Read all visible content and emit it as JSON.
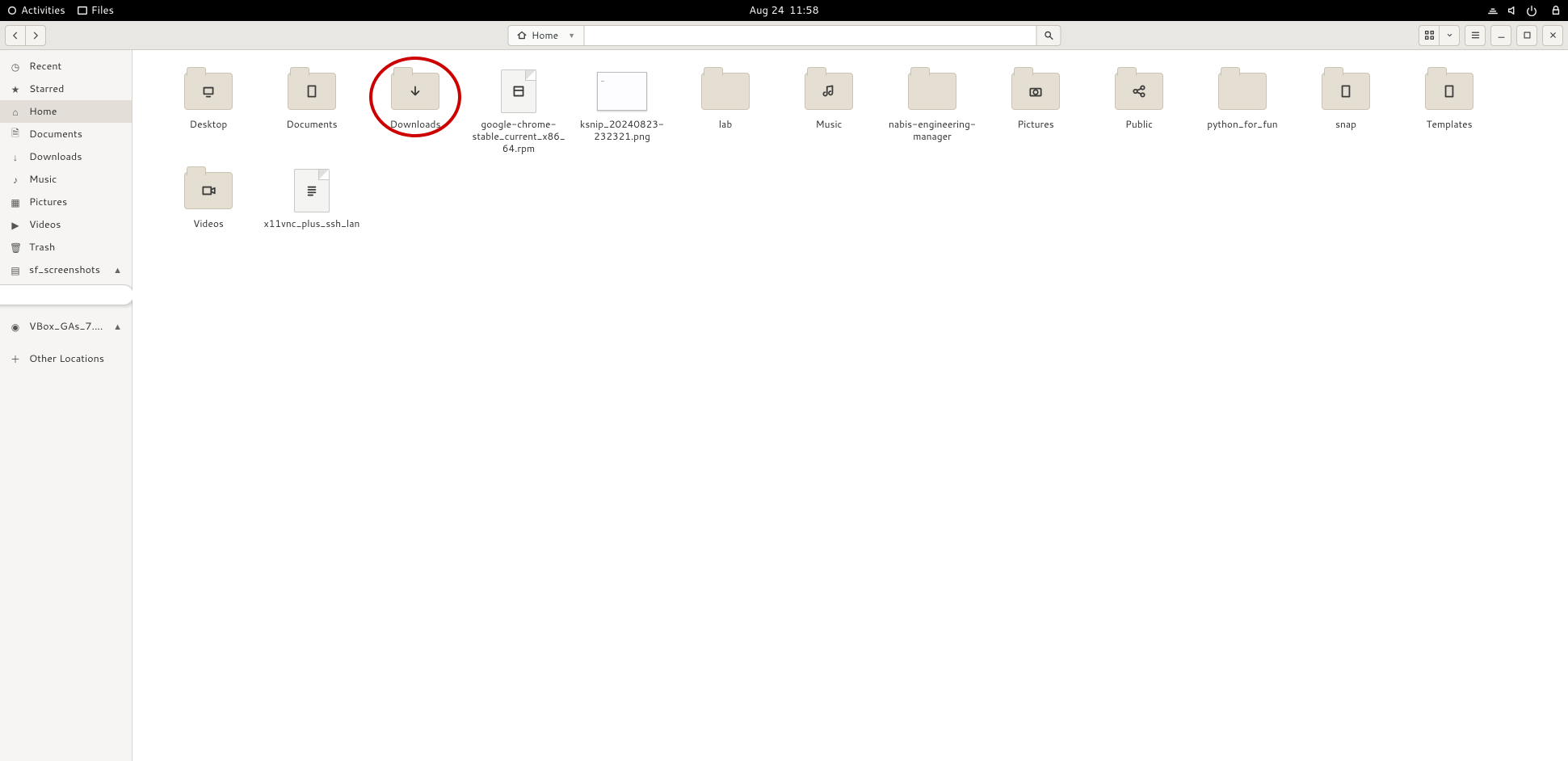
{
  "topbar": {
    "activities": "Activities",
    "app": "Files",
    "date": "Aug 24",
    "time": "11:58"
  },
  "toolbar": {
    "location": "Home"
  },
  "sidebar": {
    "items": [
      {
        "name": "recent",
        "label": "Recent"
      },
      {
        "name": "starred",
        "label": "Starred"
      },
      {
        "name": "home",
        "label": "Home",
        "selected": true
      },
      {
        "name": "documents",
        "label": "Documents"
      },
      {
        "name": "downloads",
        "label": "Downloads"
      },
      {
        "name": "music",
        "label": "Music"
      },
      {
        "name": "pictures",
        "label": "Pictures"
      },
      {
        "name": "videos",
        "label": "Videos"
      },
      {
        "name": "trash",
        "label": "Trash"
      }
    ],
    "mount1": "sf_screenshots",
    "mount2": "VBox_GAs_7....",
    "other": "Other Locations"
  },
  "files": [
    {
      "label": "Desktop",
      "type": "folder",
      "glyph": "desktop"
    },
    {
      "label": "Documents",
      "type": "folder",
      "glyph": "doc"
    },
    {
      "label": "Downloads",
      "type": "folder",
      "glyph": "down",
      "highlighted": true
    },
    {
      "label": "google-chrome-stable_current_x86_64.rpm",
      "type": "file",
      "glyph": "pkg"
    },
    {
      "label": "ksnip_20240823-232321.png",
      "type": "image"
    },
    {
      "label": "lab",
      "type": "folder",
      "glyph": ""
    },
    {
      "label": "Music",
      "type": "folder",
      "glyph": "music"
    },
    {
      "label": "nabis-engineering-manager",
      "type": "folder",
      "glyph": ""
    },
    {
      "label": "Pictures",
      "type": "folder",
      "glyph": "cam"
    },
    {
      "label": "Public",
      "type": "folder",
      "glyph": "share"
    },
    {
      "label": "python_for_fun",
      "type": "folder",
      "glyph": ""
    },
    {
      "label": "snap",
      "type": "folder",
      "glyph": "doc"
    },
    {
      "label": "Templates",
      "type": "folder",
      "glyph": "doc"
    },
    {
      "label": "Videos",
      "type": "folder",
      "glyph": "vid"
    },
    {
      "label": "x11vnc_plus_ssh_lan",
      "type": "file",
      "glyph": "txt"
    }
  ]
}
